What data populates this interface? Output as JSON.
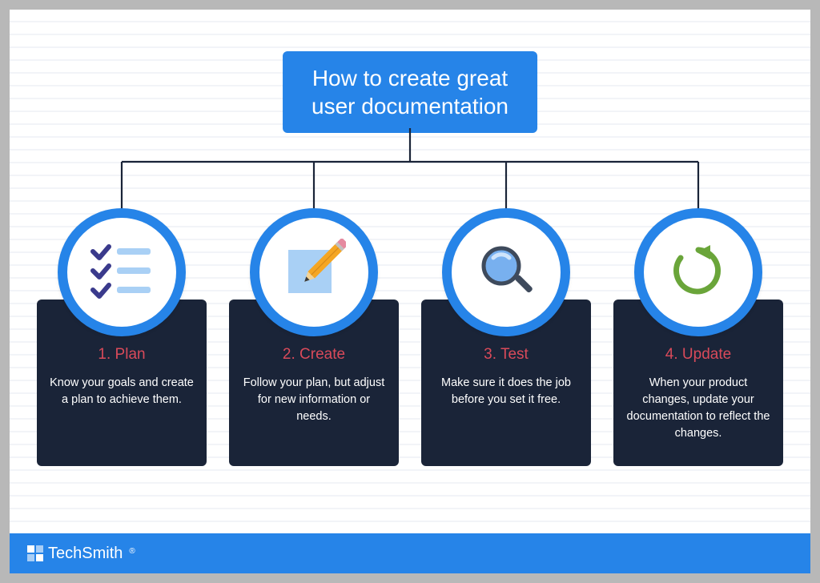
{
  "title": "How to create great\nuser documentation",
  "connector_color": "#1a2438",
  "accent_color": "#2684e8",
  "card_title_color": "#d94a5a",
  "steps": [
    {
      "icon": "checklist-icon",
      "title": "1. Plan",
      "body": "Know your goals and create a plan to achieve them."
    },
    {
      "icon": "pencil-icon",
      "title": "2. Create",
      "body": "Follow your plan, but adjust for new information or needs."
    },
    {
      "icon": "magnifier-icon",
      "title": "3. Test",
      "body": "Make sure it does the job before you set it free."
    },
    {
      "icon": "refresh-icon",
      "title": "4. Update",
      "body": "When your product changes, update your documentation to reflect the changes."
    }
  ],
  "brand": {
    "name": "TechSmith",
    "registered": "®"
  }
}
